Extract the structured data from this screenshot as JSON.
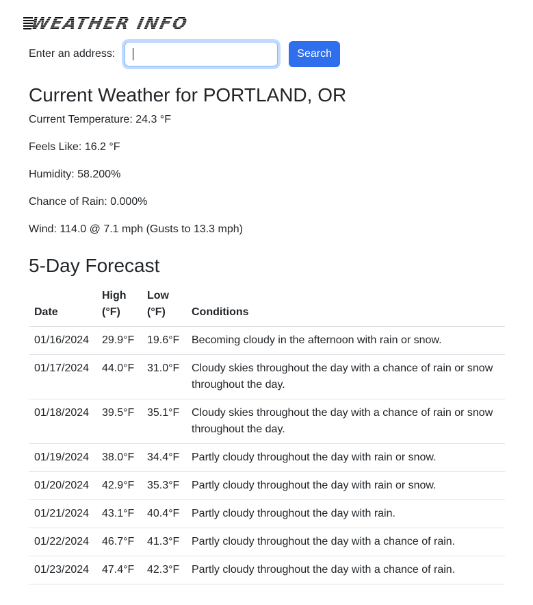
{
  "header": {
    "logo_text": "Weather Info"
  },
  "search": {
    "label": "Enter an address:",
    "value": "",
    "placeholder": "",
    "button_label": "Search"
  },
  "current": {
    "title": "Current Weather for PORTLAND, OR",
    "temperature": "Current Temperature: 24.3 °F",
    "feels_like": "Feels Like: 16.2 °F",
    "humidity": "Humidity: 58.200%",
    "rain_chance": "Chance of Rain: 0.000%",
    "wind": "Wind: 114.0 @ 7.1 mph (Gusts to 13.3 mph)"
  },
  "forecast": {
    "title": "5-Day Forecast",
    "headers": {
      "date": "Date",
      "high_line1": "High",
      "high_line2": "(°F)",
      "low_line1": "Low",
      "low_line2": "(°F)",
      "conditions": "Conditions"
    },
    "rows": [
      {
        "date": "01/16/2024",
        "high": "29.9°F",
        "low": "19.6°F",
        "conditions": "Becoming cloudy in the afternoon with rain or snow."
      },
      {
        "date": "01/17/2024",
        "high": "44.0°F",
        "low": "31.0°F",
        "conditions": "Cloudy skies throughout the day with a chance of rain or snow throughout the day."
      },
      {
        "date": "01/18/2024",
        "high": "39.5°F",
        "low": "35.1°F",
        "conditions": "Cloudy skies throughout the day with a chance of rain or snow throughout the day."
      },
      {
        "date": "01/19/2024",
        "high": "38.0°F",
        "low": "34.4°F",
        "conditions": "Partly cloudy throughout the day with rain or snow."
      },
      {
        "date": "01/20/2024",
        "high": "42.9°F",
        "low": "35.3°F",
        "conditions": "Partly cloudy throughout the day with rain or snow."
      },
      {
        "date": "01/21/2024",
        "high": "43.1°F",
        "low": "40.4°F",
        "conditions": "Partly cloudy throughout the day with rain."
      },
      {
        "date": "01/22/2024",
        "high": "46.7°F",
        "low": "41.3°F",
        "conditions": "Partly cloudy throughout the day with a chance of rain."
      },
      {
        "date": "01/23/2024",
        "high": "47.4°F",
        "low": "42.3°F",
        "conditions": "Partly cloudy throughout the day with a chance of rain."
      }
    ]
  },
  "colors": {
    "primary_button": "#2f6fed",
    "text": "#212529",
    "table_border": "#dee2e6",
    "focus_ring": "#86b7fe"
  }
}
